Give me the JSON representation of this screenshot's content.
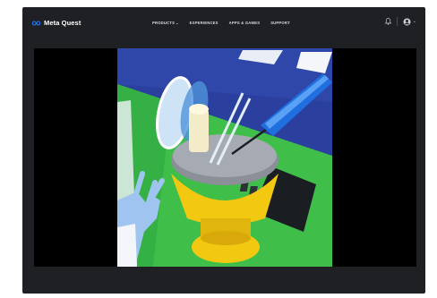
{
  "brand": {
    "name": "Meta Quest"
  },
  "nav": {
    "items": [
      {
        "label": "PRODUCTS",
        "has_dropdown": true
      },
      {
        "label": "EXPERIENCES"
      },
      {
        "label": "APPS & GAMES"
      },
      {
        "label": "SUPPORT"
      }
    ],
    "icons": [
      "bell-icon",
      "account-icon"
    ]
  },
  "video": {
    "scene": "VR hand-held tools scene"
  },
  "colors": {
    "nav_bg": "#1e2024",
    "player_bg": "#000000",
    "scene_sky": "#2a3f9e",
    "scene_floor": "#3fbf4a"
  }
}
